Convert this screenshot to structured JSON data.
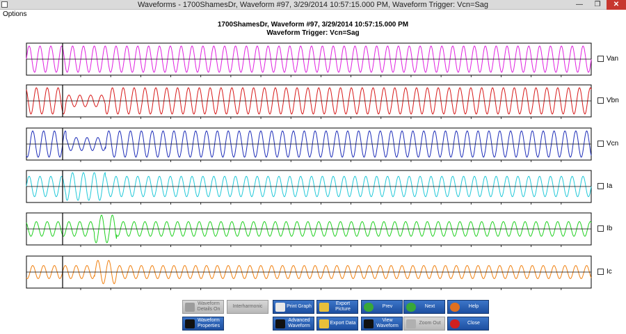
{
  "window": {
    "title": "Waveforms - 1700ShamesDr, Waveform #97, 3/29/2014 10:57:15.000 PM, Waveform Trigger: Vcn=Sag",
    "minimize_glyph": "—",
    "maximize_glyph": "❐",
    "close_glyph": "✕"
  },
  "menu": {
    "items": [
      "Options"
    ]
  },
  "header": {
    "title": "1700ShamesDr, Waveform #97, 3/29/2014 10:57:15.000 PM",
    "subtitle": "Waveform Trigger: Vcn=Sag"
  },
  "chart_data": [
    {
      "type": "line",
      "series": [
        {
          "name": "Van",
          "color": "#e020e0"
        }
      ],
      "trigger_marker": true,
      "legend_checked": false
    },
    {
      "type": "line",
      "series": [
        {
          "name": "Vbn",
          "color": "#d81818"
        }
      ],
      "trigger_marker": true,
      "legend_checked": false
    },
    {
      "type": "line",
      "series": [
        {
          "name": "Vcn",
          "color": "#1c2cb8"
        }
      ],
      "trigger_marker": true,
      "legend_checked": false
    },
    {
      "type": "line",
      "series": [
        {
          "name": "Ia",
          "color": "#20c8d8"
        }
      ],
      "trigger_marker": true,
      "legend_checked": false
    },
    {
      "type": "line",
      "series": [
        {
          "name": "Ib",
          "color": "#20d020"
        }
      ],
      "trigger_marker": true,
      "legend_checked": false
    },
    {
      "type": "line",
      "series": [
        {
          "name": "Ic",
          "color": "#f08010"
        }
      ],
      "trigger_marker": true,
      "legend_checked": false
    }
  ],
  "buttons": {
    "waveform_details_on": {
      "label": "Waveform Details On",
      "enabled": false,
      "icon": "details-icon"
    },
    "interharmonic": {
      "label": "Interharmonic",
      "enabled": false,
      "icon": ""
    },
    "print_graph": {
      "label": "Print Graph",
      "enabled": true,
      "icon": "printer-icon"
    },
    "export_picture": {
      "label": "Export Picture",
      "enabled": true,
      "icon": "picture-icon"
    },
    "prev": {
      "label": "Prev",
      "enabled": true,
      "icon": "arrow-left-icon"
    },
    "next": {
      "label": "Next",
      "enabled": true,
      "icon": "arrow-right-icon"
    },
    "help": {
      "label": "Help",
      "enabled": true,
      "icon": "help-icon"
    },
    "waveform_properties": {
      "label": "Waveform Properties",
      "enabled": true,
      "icon": "waveform-icon"
    },
    "advanced_waveform": {
      "label": "Advanced Waveform",
      "enabled": true,
      "icon": "waveform-icon"
    },
    "export_data": {
      "label": "Export Data",
      "enabled": true,
      "icon": "data-icon"
    },
    "view_waveform": {
      "label": "View Waveform",
      "enabled": true,
      "icon": "waveform-icon"
    },
    "zoom_out": {
      "label": "Zoom Out",
      "enabled": false,
      "icon": "zoom-icon"
    },
    "close": {
      "label": "Close",
      "enabled": true,
      "icon": "close-icon"
    }
  }
}
